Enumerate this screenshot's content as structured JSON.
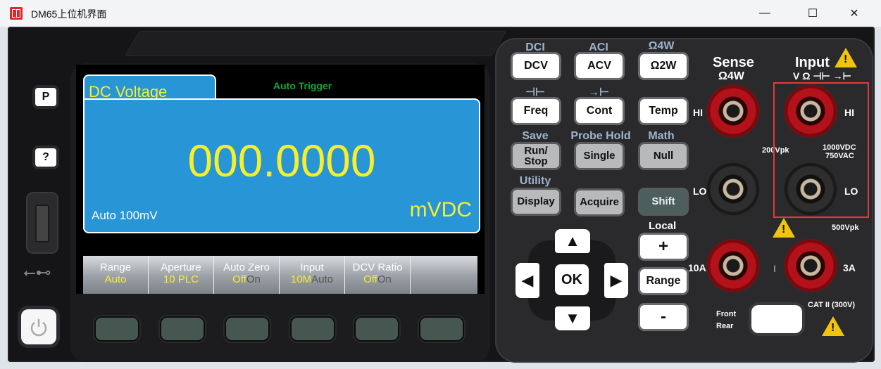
{
  "window": {
    "title": "DM65上位机界面",
    "minimize": "—",
    "maximize": "☐",
    "close": "✕"
  },
  "side": {
    "p_label": "P",
    "help_label": "?"
  },
  "screen": {
    "tab_title": "DC Voltage",
    "trigger": "Auto Trigger",
    "reading": "000.0000",
    "range_info": "Auto 100mV",
    "unit": "mVDC"
  },
  "softkeys": [
    {
      "title": "Range",
      "v1": "Auto",
      "v2": ""
    },
    {
      "title": "Aperture",
      "v1": "10 PLC",
      "v2": ""
    },
    {
      "title": "Auto Zero",
      "v1": "Off",
      "v2": "On"
    },
    {
      "title": "Input",
      "v1": "10M",
      "v2": "Auto"
    },
    {
      "title": "DCV Ratio",
      "v1": "Off",
      "v2": "On"
    },
    {
      "title": "",
      "v1": "",
      "v2": ""
    }
  ],
  "keys": {
    "dci": "DCI",
    "dcv": "DCV",
    "aci": "ACI",
    "acv": "ACV",
    "o4w_top": "Ω4W",
    "o2w": "Ω2W",
    "cap_sym": "⊣⊢",
    "freq": "Freq",
    "diode_sym": "→⊢",
    "cont": "Cont",
    "temp": "Temp",
    "save": "Save",
    "run_stop": "Run/\nStop",
    "probe_hold": "Probe Hold",
    "single": "Single",
    "math": "Math",
    "null": "Null",
    "utility": "Utility",
    "display": "Display",
    "acquire": "Acquire",
    "shift": "Shift",
    "local": "Local",
    "plus": "+",
    "range": "Range",
    "minus": "-",
    "ok": "OK",
    "up": "▲",
    "down": "▼",
    "left": "◀",
    "right": "▶"
  },
  "terminals": {
    "sense_title": "Sense",
    "sense_sub": "Ω4W",
    "input_title": "Input",
    "input_sub": "V Ω ⊣⊢ →⊢",
    "hi_left": "HI",
    "lo_left": "LO",
    "hi_right": "HI",
    "lo_right": "LO",
    "v200": "200Vpk",
    "v1000": "1000VDC",
    "v750": "750VAC",
    "v500": "500Vpk",
    "a10": "10A",
    "a3": "3A",
    "i_sym": "I",
    "front": "Front",
    "rear": "Rear",
    "cat": "CAT II (300V)"
  }
}
